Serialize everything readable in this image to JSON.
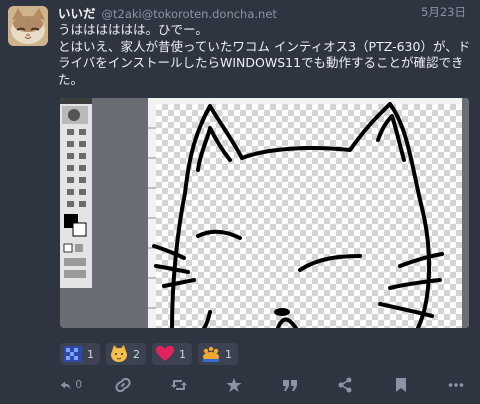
{
  "status": {
    "display_name": "いいだ",
    "acct": "@t2aki@tokoroten.doncha.net",
    "timestamp": "5月23日",
    "content": [
      "うはははははは。ひでー。",
      "とはいえ、家人が昔使っていたワコム インティオス3（PTZ-630）が、ドライバをインストールしたらWINDOWS11でも動作することが確認できた。"
    ]
  },
  "reactions": [
    {
      "emoji": "blue-checkered-emoji",
      "count": "1"
    },
    {
      "emoji": "cat-face-emoji",
      "count": "2"
    },
    {
      "emoji": "red-heart-emoji",
      "count": "1"
    },
    {
      "emoji": "cat-paw-emoji",
      "count": "1"
    }
  ],
  "actions": {
    "reply_count": "0",
    "icons": [
      "reply-icon",
      "link-icon",
      "boost-icon",
      "favourite-icon",
      "quote-icon",
      "share-icon",
      "bookmark-icon",
      "more-icon"
    ]
  },
  "colors": {
    "background": "#2f3441",
    "muted_text": "#8c93a4",
    "heart": "#e0245e"
  }
}
